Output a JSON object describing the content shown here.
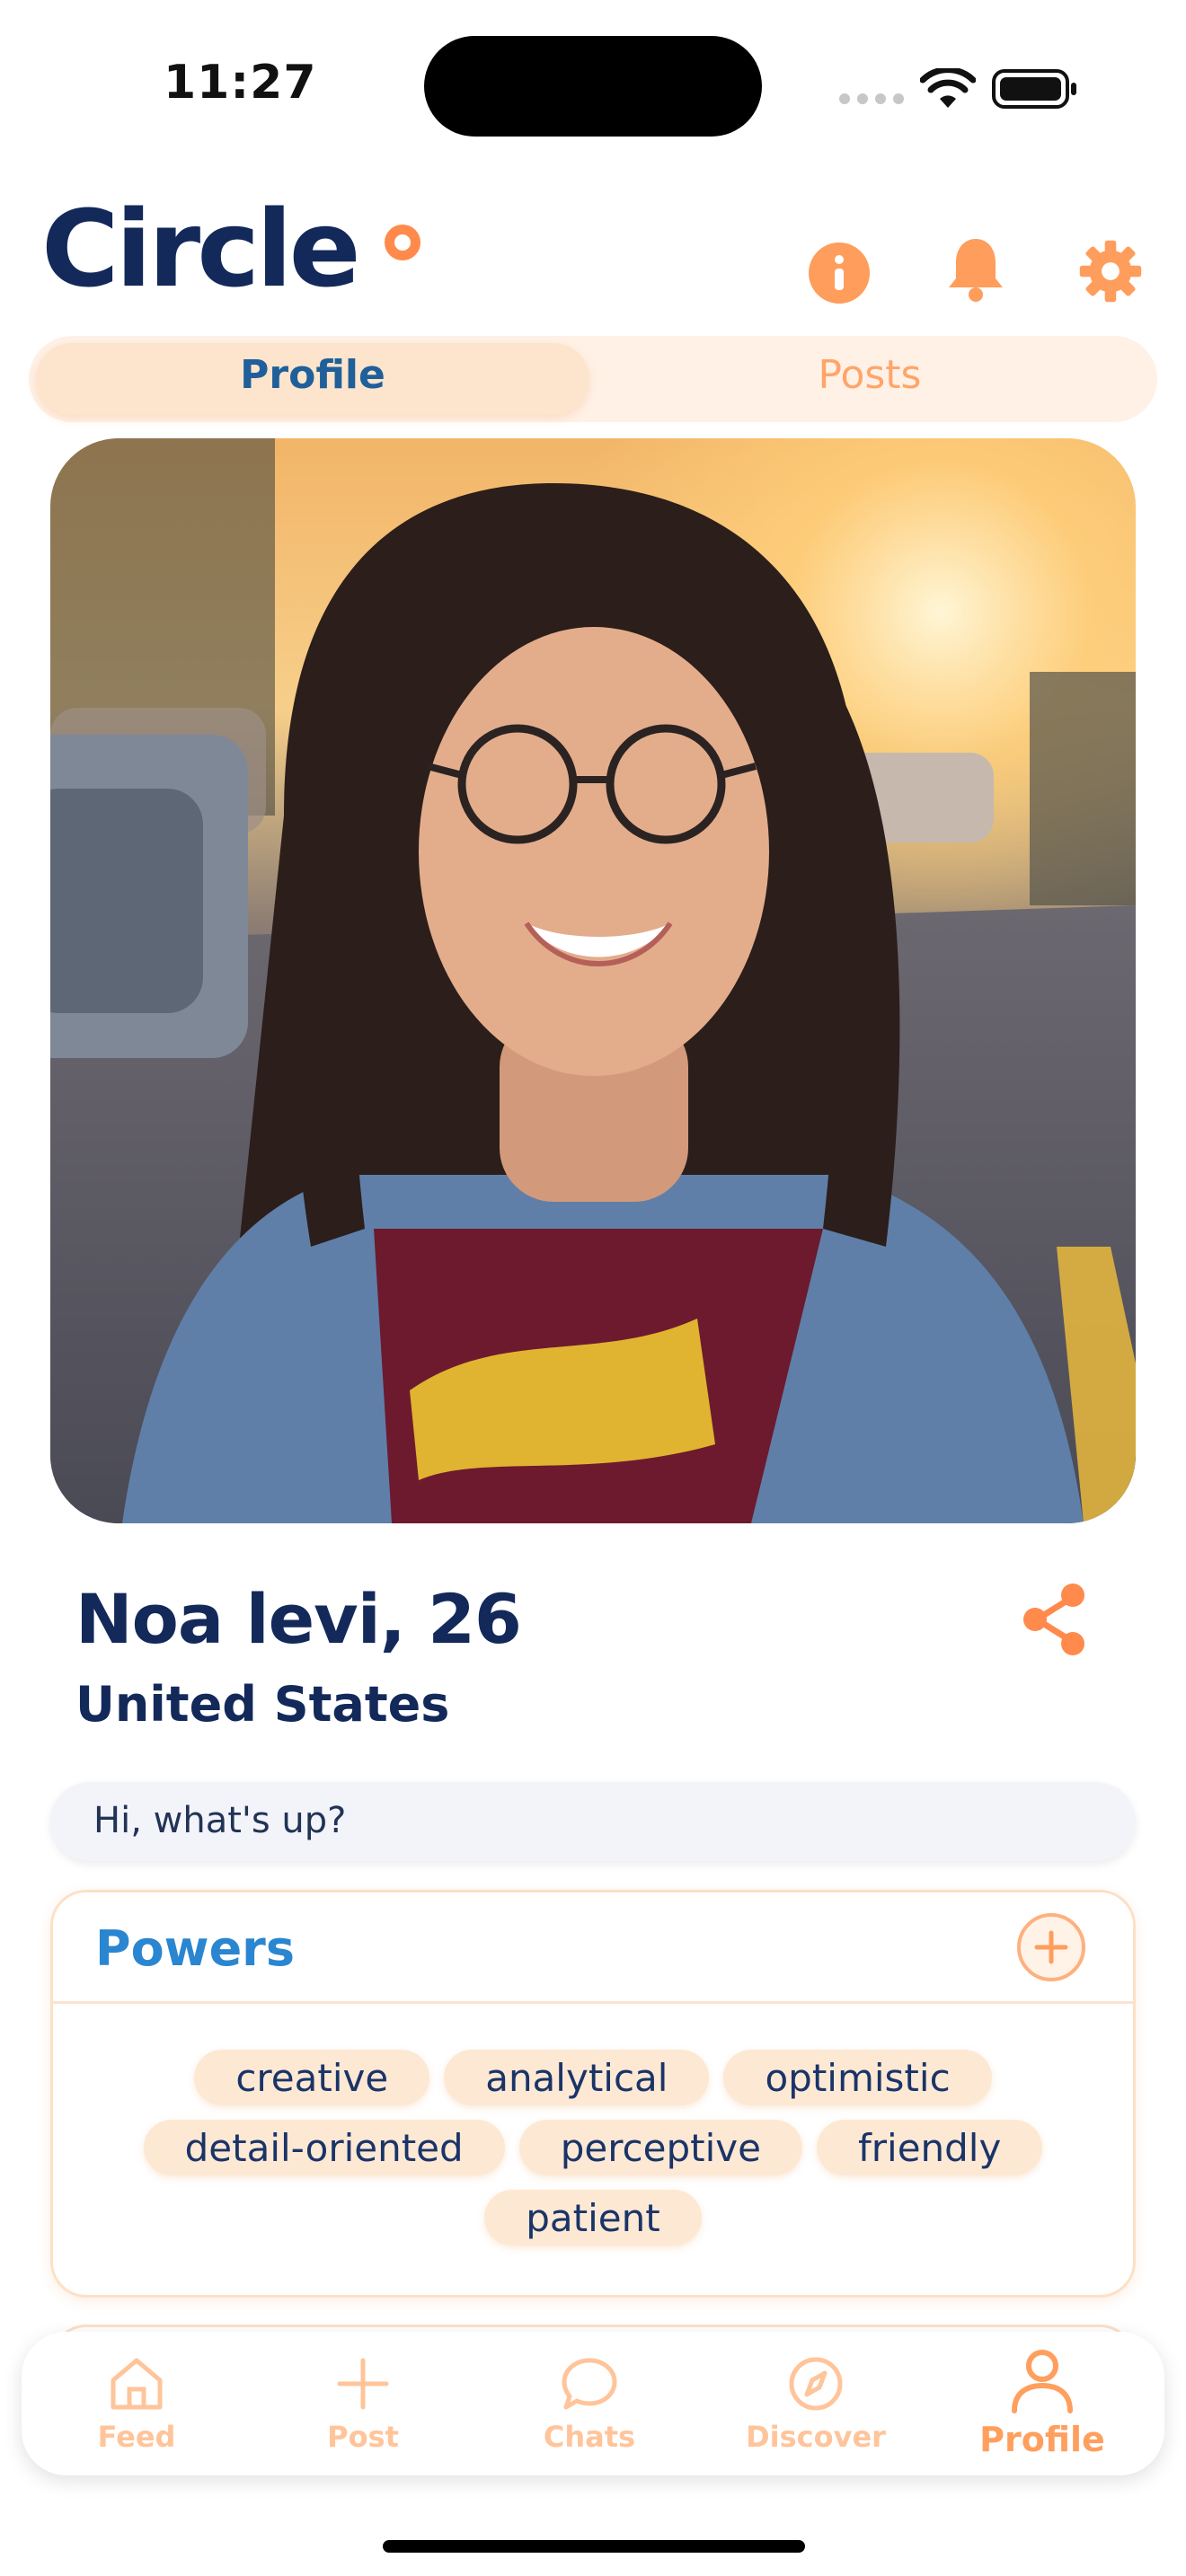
{
  "status_bar": {
    "time": "11:27"
  },
  "header": {
    "app_name": "Circle",
    "icons": [
      "info-icon",
      "bell-icon",
      "gear-icon"
    ],
    "accent": "#ff8a4c"
  },
  "tabs": [
    {
      "label": "Profile",
      "active": true
    },
    {
      "label": "Posts",
      "active": false
    }
  ],
  "profile": {
    "name_age": "Noa levi, 26",
    "country": "United States",
    "bio": "Hi, what's up?"
  },
  "powers": {
    "title": "Powers",
    "tags": [
      "creative",
      "analytical",
      "optimistic",
      "detail-oriented",
      "perceptive",
      "friendly",
      "patient"
    ]
  },
  "nav": {
    "items": [
      {
        "label": "Feed",
        "icon": "home-icon"
      },
      {
        "label": "Post",
        "icon": "plus-icon"
      },
      {
        "label": "Chats",
        "icon": "chat-bubble-icon"
      },
      {
        "label": "Discover",
        "icon": "compass-icon"
      },
      {
        "label": "Profile",
        "icon": "person-icon",
        "active": true
      }
    ]
  }
}
